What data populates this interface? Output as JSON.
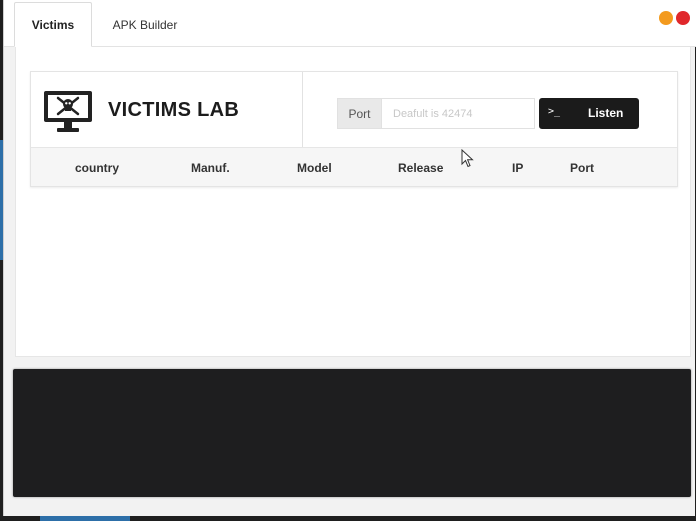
{
  "tabs": [
    {
      "label": "Victims",
      "active": true
    },
    {
      "label": "APK Builder",
      "active": false
    }
  ],
  "window_controls": {
    "minimize_color": "#f39a1e",
    "close_color": "#e0282b"
  },
  "header": {
    "title": "VICTIMS LAB",
    "icon": "monitor-skull-icon"
  },
  "port_form": {
    "label": "Port",
    "placeholder": "Deafult is 42474",
    "value": "",
    "button_icon": ">_",
    "button_label": "Listen"
  },
  "table": {
    "columns": [
      "country",
      "Manuf.",
      "Model",
      "Release",
      "IP",
      "Port"
    ],
    "rows": []
  },
  "colors": {
    "accent_dark": "#1b1b1b",
    "console_bg": "#1e1e1f"
  }
}
